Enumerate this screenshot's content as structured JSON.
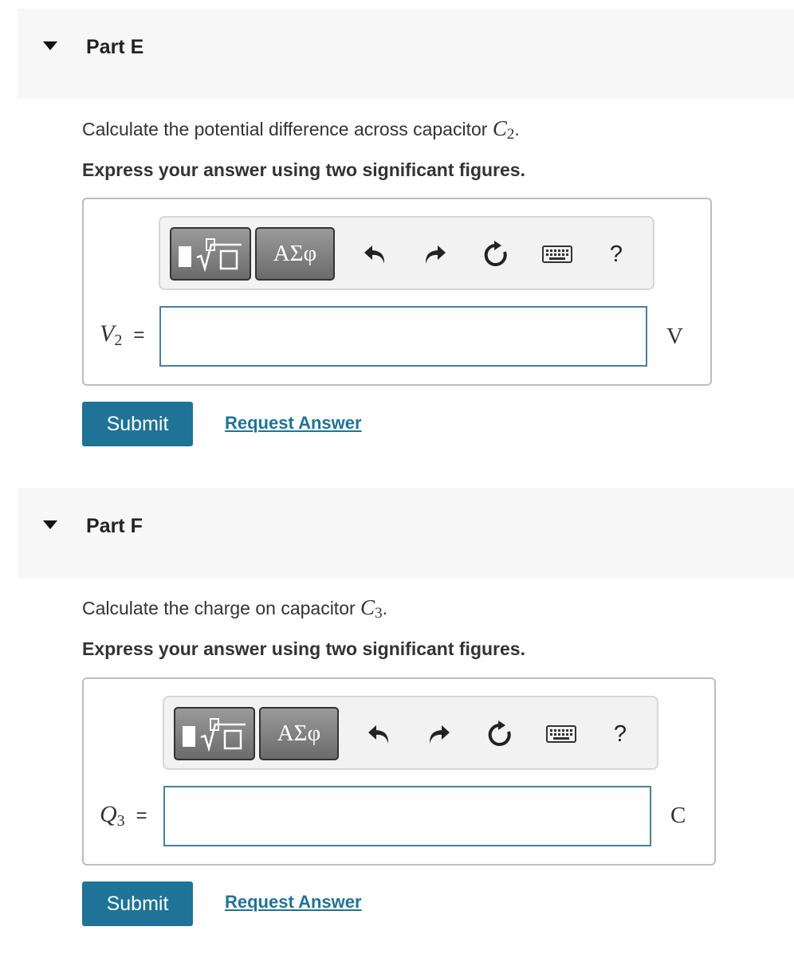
{
  "parts": [
    {
      "title": "Part E",
      "question_text": "Calculate the potential difference across capacitor ",
      "question_symbol": "C",
      "question_subscript": "2",
      "question_end": ".",
      "instruction": "Express your answer using two significant figures.",
      "toolbar": {
        "symbols_label": "ΑΣφ",
        "help_label": "?"
      },
      "variable": "V",
      "variable_subscript": "2",
      "equals": "=",
      "input_value": "",
      "unit": "V",
      "submit_label": "Submit",
      "request_label": "Request Answer"
    },
    {
      "title": "Part F",
      "question_text": "Calculate the charge on capacitor ",
      "question_symbol": "C",
      "question_subscript": "3",
      "question_end": ".",
      "instruction": "Express your answer using two significant figures.",
      "toolbar": {
        "symbols_label": "ΑΣφ",
        "help_label": "?"
      },
      "variable": "Q",
      "variable_subscript": "3",
      "equals": "=",
      "input_value": "",
      "unit": "C",
      "submit_label": "Submit",
      "request_label": "Request Answer"
    }
  ],
  "colors": {
    "accent": "#1f7396",
    "input_border": "#4a7f9a",
    "header_bg": "#f7f7f7"
  },
  "icons": [
    "caret-down-icon",
    "templates-icon",
    "undo-icon",
    "redo-icon",
    "reset-icon",
    "keyboard-icon",
    "help-icon"
  ]
}
